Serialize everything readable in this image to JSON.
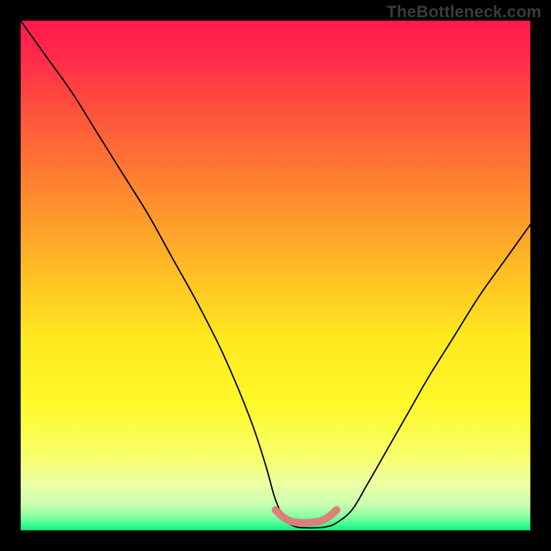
{
  "watermark": "TheBottleneck.com",
  "chart_data": {
    "type": "line",
    "title": "",
    "xlabel": "",
    "ylabel": "",
    "xlim": [
      0,
      100
    ],
    "ylim": [
      0,
      100
    ],
    "background_gradient": {
      "direction": "vertical",
      "stops": [
        {
          "pos": 0.0,
          "color": "#ff1a4d"
        },
        {
          "pos": 0.07,
          "color": "#ff2a4a"
        },
        {
          "pos": 0.2,
          "color": "#ff5a3a"
        },
        {
          "pos": 0.35,
          "color": "#ff8c2e"
        },
        {
          "pos": 0.5,
          "color": "#ffc024"
        },
        {
          "pos": 0.62,
          "color": "#ffe81f"
        },
        {
          "pos": 0.75,
          "color": "#fff82a"
        },
        {
          "pos": 0.85,
          "color": "#f8ff66"
        },
        {
          "pos": 0.91,
          "color": "#ecffa5"
        },
        {
          "pos": 0.95,
          "color": "#c8ffb0"
        },
        {
          "pos": 0.975,
          "color": "#80ff9e"
        },
        {
          "pos": 0.988,
          "color": "#3dff94"
        },
        {
          "pos": 1.0,
          "color": "#16e877"
        }
      ]
    },
    "series": [
      {
        "name": "bottleneck-curve",
        "color": "#000000",
        "stroke_width": 2,
        "x": [
          0,
          5,
          10,
          15,
          20,
          25,
          30,
          35,
          40,
          45,
          48,
          50,
          52,
          54,
          56,
          58,
          60,
          62,
          65,
          68,
          72,
          76,
          80,
          85,
          90,
          95,
          100
        ],
        "y": [
          100,
          93,
          86,
          78,
          70,
          62,
          53,
          44,
          34,
          22,
          13,
          6,
          2,
          0.7,
          0.5,
          0.5,
          0.7,
          1.5,
          4,
          9,
          16,
          23,
          30,
          38,
          46,
          53,
          60
        ]
      }
    ],
    "highlight": {
      "name": "minimum-band",
      "color": "#e27a78",
      "stroke_width": 11,
      "x": [
        50,
        51.5,
        53,
        54.5,
        56,
        57.5,
        59,
        60.5,
        62
      ],
      "y": [
        4.0,
        2.6,
        1.8,
        1.5,
        1.5,
        1.6,
        1.9,
        2.7,
        4.0
      ]
    }
  }
}
